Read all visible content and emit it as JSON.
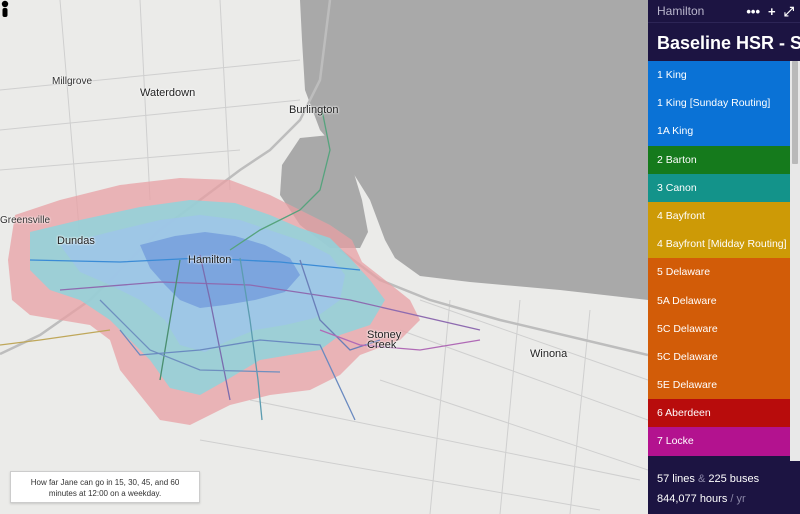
{
  "map": {
    "places": {
      "millgrove": "Millgrove",
      "waterdown": "Waterdown",
      "burlington": "Burlington",
      "dundas": "Dundas",
      "hamilton": "Hamilton",
      "greensville": "Greensville",
      "stoney_creek": "Stoney Creek",
      "winona": "Winona"
    },
    "caption": "How far Jane can go in 15, 30, 45, and 60 minutes at 12:00 on a weekday."
  },
  "panel": {
    "city": "Hamilton",
    "more_icon": "•••",
    "add_icon": "+",
    "collapse_icon": "⤢",
    "scenario_title": "Baseline HSR - Sto",
    "lines": [
      {
        "label": "1 King",
        "color": "#0a72d6"
      },
      {
        "label": "1 King [Sunday Routing]",
        "color": "#0a72d6"
      },
      {
        "label": "1A King",
        "color": "#0a72d6"
      },
      {
        "label": "2 Barton",
        "color": "#157a1c"
      },
      {
        "label": "3 Canon",
        "color": "#13938a"
      },
      {
        "label": "4 Bayfront",
        "color": "#cd9a06"
      },
      {
        "label": "4 Bayfront [Midday Routing]",
        "color": "#cd9a06"
      },
      {
        "label": "5 Delaware",
        "color": "#d25c08"
      },
      {
        "label": "5A Delaware",
        "color": "#d25c08"
      },
      {
        "label": "5C Delaware",
        "color": "#d25c08"
      },
      {
        "label": "5C Delaware",
        "color": "#d25c08"
      },
      {
        "label": "5E Delaware",
        "color": "#d25c08"
      },
      {
        "label": "6 Aberdeen",
        "color": "#b80c0c"
      },
      {
        "label": "7 Locke",
        "color": "#b3128f"
      }
    ],
    "stats": {
      "lines_count": "57 lines",
      "amp": "&",
      "buses_count": "225 buses",
      "hours": "844,077 hours",
      "per_year": "/ yr"
    }
  }
}
